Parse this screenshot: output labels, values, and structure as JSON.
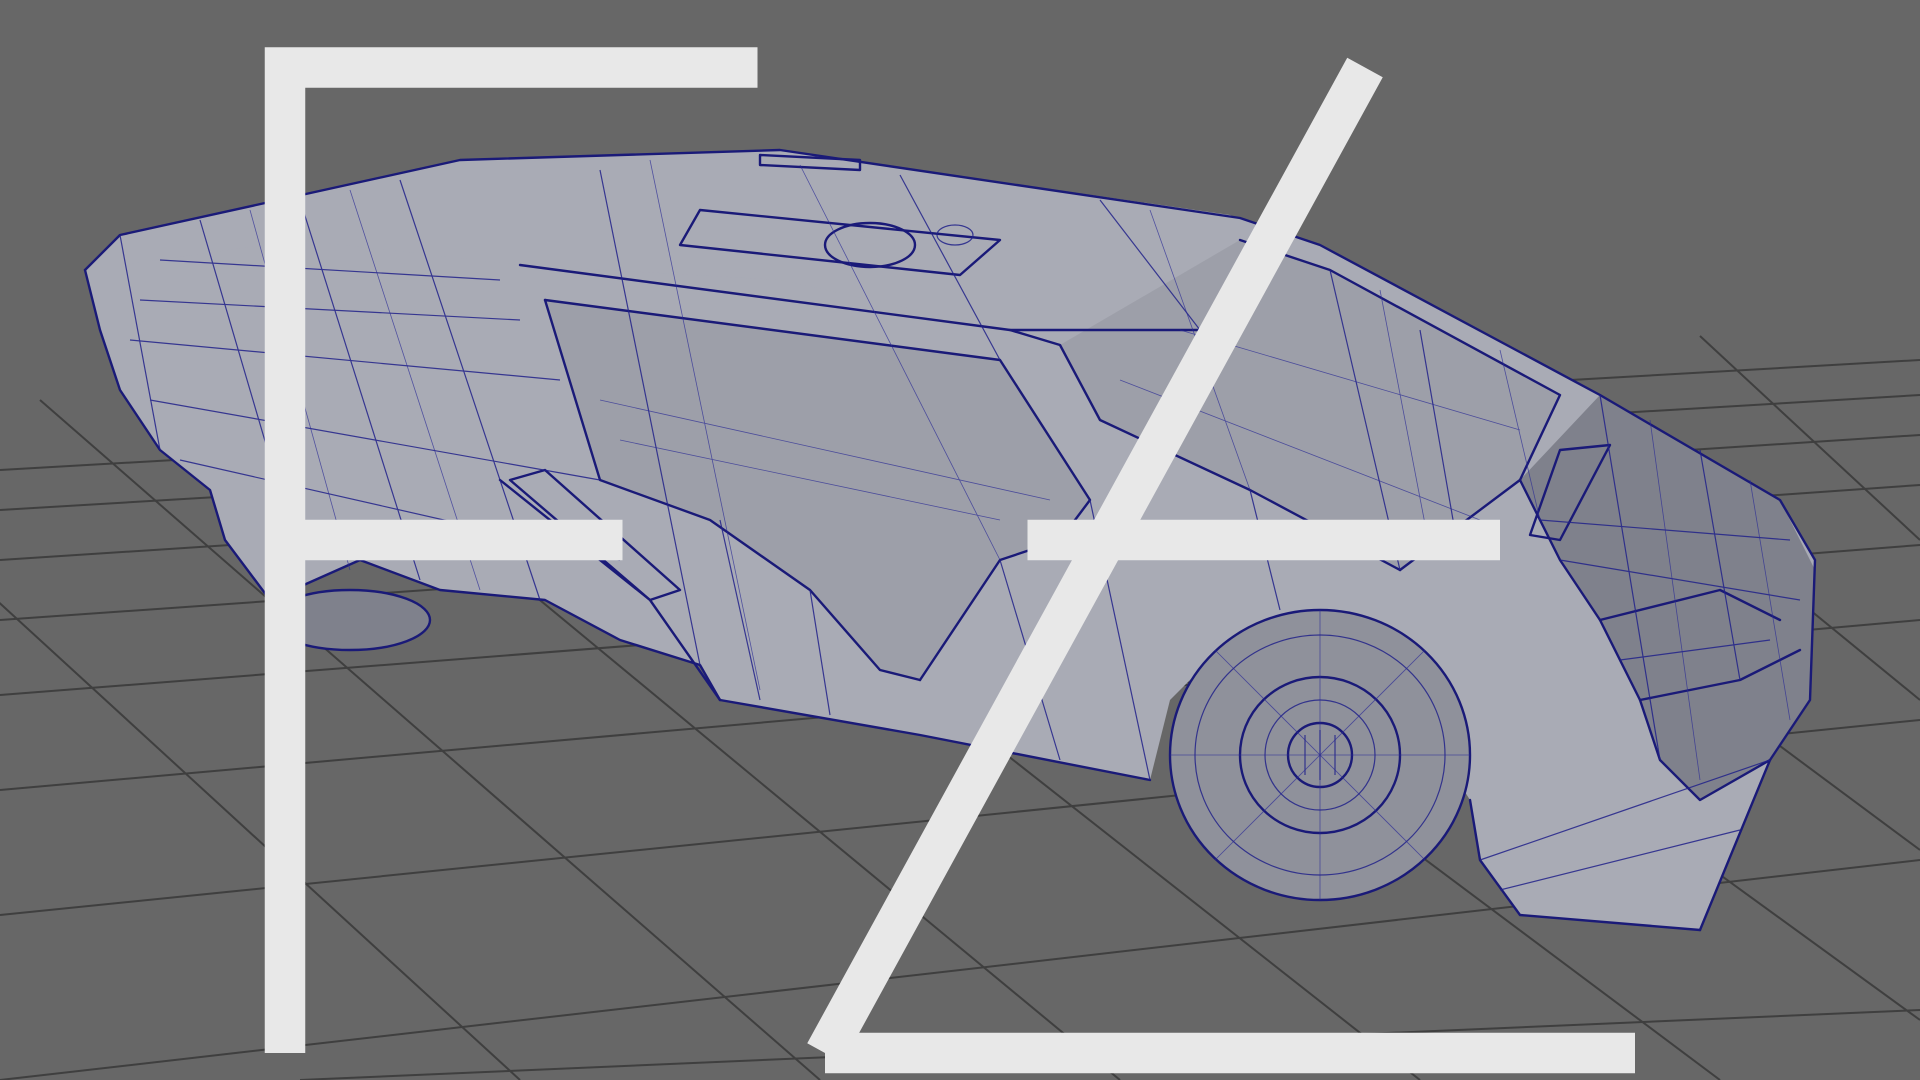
{
  "viewport": {
    "background": "#676767",
    "grid_color": "#3f3f3f",
    "wireframe_color": "#1a1a78",
    "surface_color": "#a9abb5",
    "display_mode": "wireframe-on-shaded"
  },
  "scene": {
    "object": "futuristic-car-model",
    "ground": "perspective-grid"
  },
  "watermark": {
    "icon": "fe-logo-icon",
    "color": "#e8e8e8"
  }
}
